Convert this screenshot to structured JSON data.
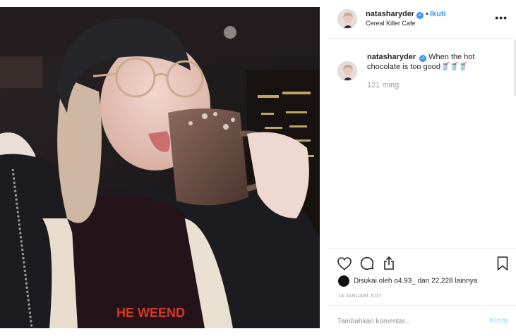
{
  "post": {
    "owner": {
      "username": "natasharyder",
      "verified_mark": "✓",
      "separator": "•",
      "follow_label": "Ikuti",
      "location": "Cereal Killer Cafe"
    },
    "more_options_label": "•••",
    "caption": {
      "username": "natasharyder",
      "text": "When the hot chocolate is too good",
      "emoji": "🥤🥤🥤",
      "time_ago": "121 ming"
    },
    "likes": {
      "text": "Disukai oleh o4.93_ dan 22,228 lainnya"
    },
    "date": "14 JANUARI 2017",
    "comment_input": {
      "placeholder": "Tambahkan komentar...",
      "post_label": "Kirim"
    },
    "photo": {
      "sweatshirt_text": "HE WEEND"
    },
    "colors": {
      "accent_blue": "#3897f0",
      "muted_blue": "#b2dffc",
      "border": "#efefef",
      "secondary_text": "#999999"
    }
  }
}
